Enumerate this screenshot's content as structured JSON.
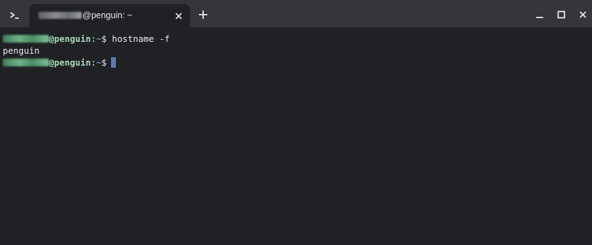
{
  "titlebar": {
    "app_icon": "terminal-prompt-icon",
    "tab": {
      "title_suffix": "@penguin: ~",
      "close_icon": "close-icon"
    },
    "new_tab_icon": "plus-icon",
    "window_controls": [
      "minimize-icon",
      "maximize-icon",
      "close-icon"
    ]
  },
  "terminal": {
    "lines": [
      {
        "host": "@penguin",
        "separator": ":",
        "path": "~",
        "prompt": "$ ",
        "command": "hostname -f"
      },
      {
        "output": "penguin"
      },
      {
        "host": "@penguin",
        "separator": ":",
        "path": "~",
        "prompt": "$",
        "command": ""
      }
    ],
    "colors": {
      "background": "#202124",
      "host": "#a8dab5",
      "cursor": "#5c7ab0"
    }
  }
}
